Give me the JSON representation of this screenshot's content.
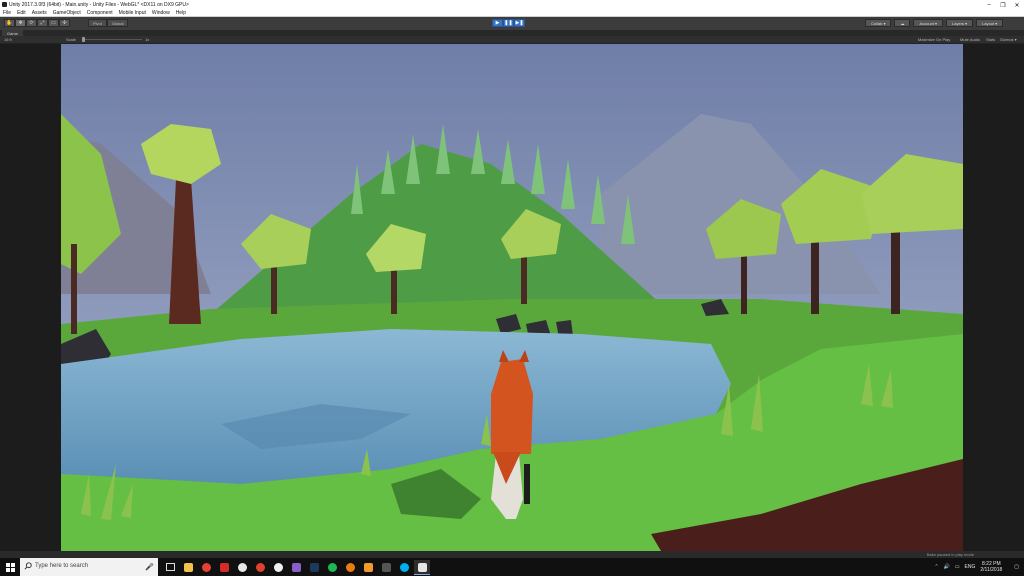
{
  "window": {
    "title": "Unity 2017.3.0f3 (64bit) - Main.unity - Unity Files - WebGL* <DX11 on DX9 GPU>",
    "minimize": "–",
    "maximize": "❐",
    "close": "✕"
  },
  "menu": [
    "File",
    "Edit",
    "Assets",
    "GameObject",
    "Component",
    "Mobile Input",
    "Window",
    "Help"
  ],
  "toolbar": {
    "tools": [
      "✋",
      "✥",
      "⟳",
      "⤢",
      "▭",
      "✣"
    ],
    "pivot_label": "Pivot",
    "space_label": "Global",
    "play": "▶",
    "pause": "❚❚",
    "step": "▶❚",
    "collab_label": "Collab ▾",
    "cloud": "☁",
    "account_label": "Account ▾",
    "layers_label": "Layers ▾",
    "layout_label": "Layout ▾"
  },
  "tab": {
    "label": "Game"
  },
  "gamebar": {
    "display": "Display 1",
    "aspect": "16:9",
    "scale_label": "Scale",
    "scale_value": "1x",
    "maximize": "Maximize On Play",
    "mute": "Mute Audio",
    "stats": "Stats",
    "gizmos": "Gizmos ▾"
  },
  "status": {
    "message": "Bake paused in play mode"
  },
  "taskbar": {
    "search_placeholder": "Type here to search",
    "mic": "🎤",
    "language": "ENG",
    "time": "8:22 PM",
    "date": "2/11/2018"
  },
  "colors": {
    "accent": "#3874c4",
    "editor_dark": "#3c3c3c",
    "sky": "#7e8db3",
    "grass": "#5aa83c",
    "water": "#6e9fbf",
    "fox": "#d4541f"
  }
}
